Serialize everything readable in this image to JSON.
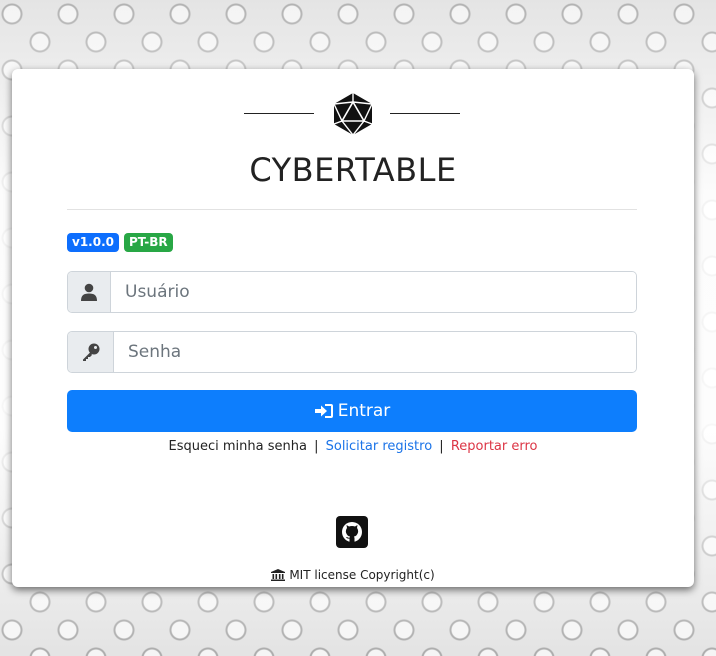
{
  "brand": {
    "title": "CYBERTABLE",
    "logo_icon": "d20-icon"
  },
  "badges": {
    "version": "v1.0.0",
    "language": "PT-BR"
  },
  "form": {
    "username": {
      "placeholder": "Usuário",
      "value": "",
      "icon": "user-icon"
    },
    "password": {
      "placeholder": "Senha",
      "value": "",
      "icon": "key-icon"
    },
    "submit_label": "Entrar",
    "submit_icon": "sign-in-icon"
  },
  "links": {
    "forgot": "Esqueci minha senha",
    "register": "Solicitar registro",
    "report": "Reportar erro",
    "separator": "|"
  },
  "footer": {
    "github_icon": "github-icon",
    "license_icon": "bank-icon",
    "text": "MIT license Copyright(c)"
  },
  "colors": {
    "primary": "#0d7efd",
    "success": "#28a745",
    "danger": "#dc3545",
    "link": "#1a73e8"
  }
}
